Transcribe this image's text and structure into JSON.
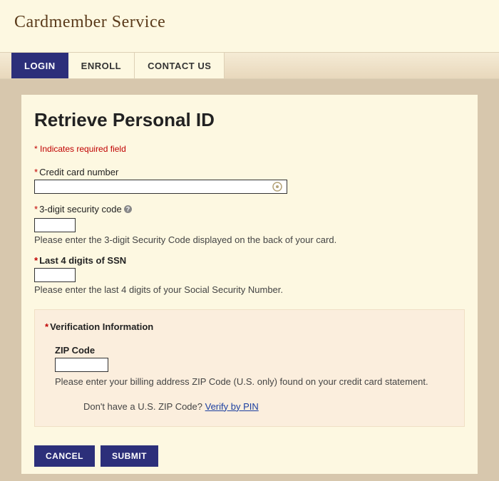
{
  "brand": "Cardmember Service",
  "nav": {
    "login": "LOGIN",
    "enroll": "ENROLL",
    "contact": "CONTACT US"
  },
  "page": {
    "title": "Retrieve Personal ID",
    "required_note": "Indicates required field"
  },
  "fields": {
    "cc": {
      "label": "Credit card number",
      "value": ""
    },
    "cvv": {
      "label": "3-digit security code",
      "value": "",
      "help": "Please enter the 3-digit Security Code displayed on the back of your card."
    },
    "ssn": {
      "label": "Last 4 digits of SSN",
      "value": "",
      "help": "Please enter the last 4 digits of your Social Security Number."
    }
  },
  "verification": {
    "title": "Verification Information",
    "zip": {
      "label": "ZIP Code",
      "value": "",
      "help": "Please enter your billing address ZIP Code (U.S. only) found on your credit card statement."
    },
    "pin_text": "Don't have a U.S. ZIP Code? ",
    "pin_link": "Verify by PIN"
  },
  "buttons": {
    "cancel": "CANCEL",
    "submit": "SUBMIT"
  }
}
